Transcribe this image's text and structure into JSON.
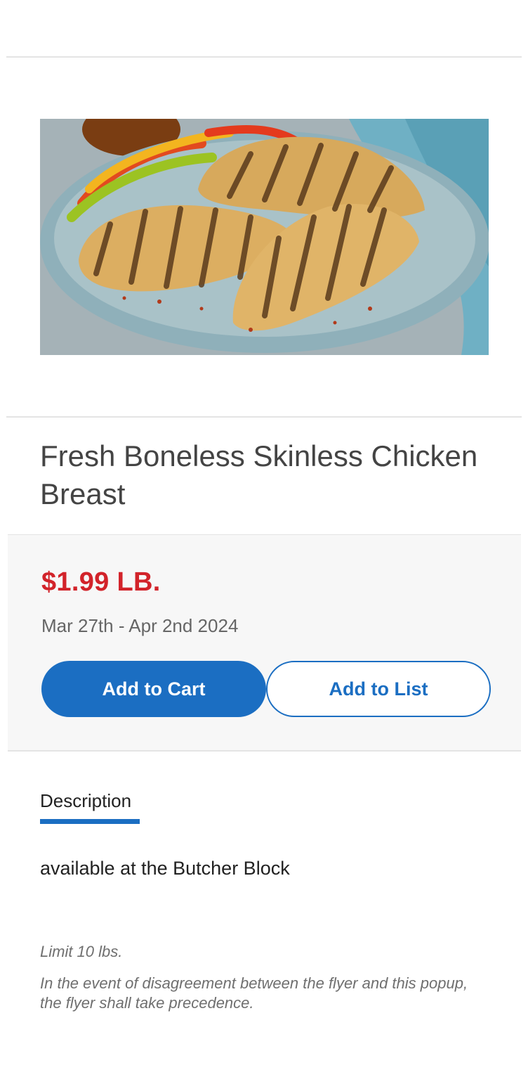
{
  "product": {
    "image_alt": "Grilled chicken breasts on a plate with sliced peppers",
    "title": "Fresh Boneless Skinless Chicken Breast"
  },
  "pricing": {
    "price": "$1.99 LB.",
    "valid_dates": "Mar 27th - Apr 2nd 2024",
    "add_to_cart_label": "Add to Cart",
    "add_to_list_label": "Add to List"
  },
  "details": {
    "tab_label": "Description",
    "description": "available at the Butcher Block",
    "limit": "Limit 10 lbs.",
    "disclaimer": "In the event of disagreement between the flyer and this popup, the flyer shall take precedence."
  },
  "colors": {
    "accent": "#1b6ec2",
    "price": "#d2232a",
    "panel_bg": "#f7f7f7",
    "divider": "#e4e4e4"
  }
}
